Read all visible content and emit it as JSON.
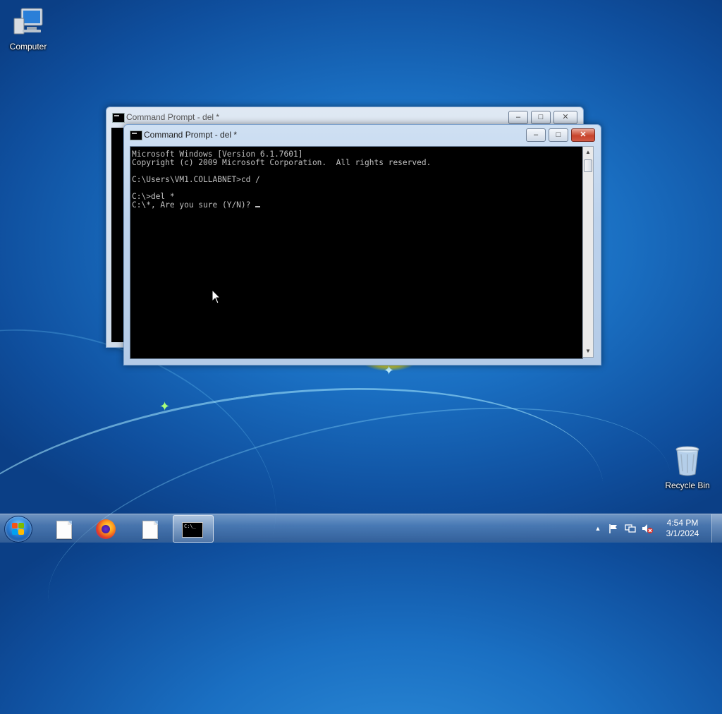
{
  "desktop": {
    "icons": [
      {
        "label": "Computer"
      },
      {
        "label": "Recycle Bin"
      }
    ]
  },
  "windows": {
    "background": {
      "title": "Command Prompt - del  *"
    },
    "foreground": {
      "title": "Command Prompt - del  *",
      "console_lines": [
        "Microsoft Windows [Version 6.1.7601]",
        "Copyright (c) 2009 Microsoft Corporation.  All rights reserved.",
        "",
        "C:\\Users\\VM1.COLLABNET>cd /",
        "",
        "C:\\>del *",
        "C:\\*, Are you sure (Y/N)? "
      ],
      "buttons": {
        "minimize": "–",
        "maximize": "□",
        "close": "✕"
      }
    }
  },
  "taskbar": {
    "pinned": [
      {
        "name": "document"
      },
      {
        "name": "firefox"
      },
      {
        "name": "document"
      },
      {
        "name": "command-prompt",
        "active": true
      }
    ],
    "cmd_glyph": "C:\\_",
    "tray": {
      "expand": "▲",
      "time": "4:54 PM",
      "date": "3/1/2024"
    }
  }
}
